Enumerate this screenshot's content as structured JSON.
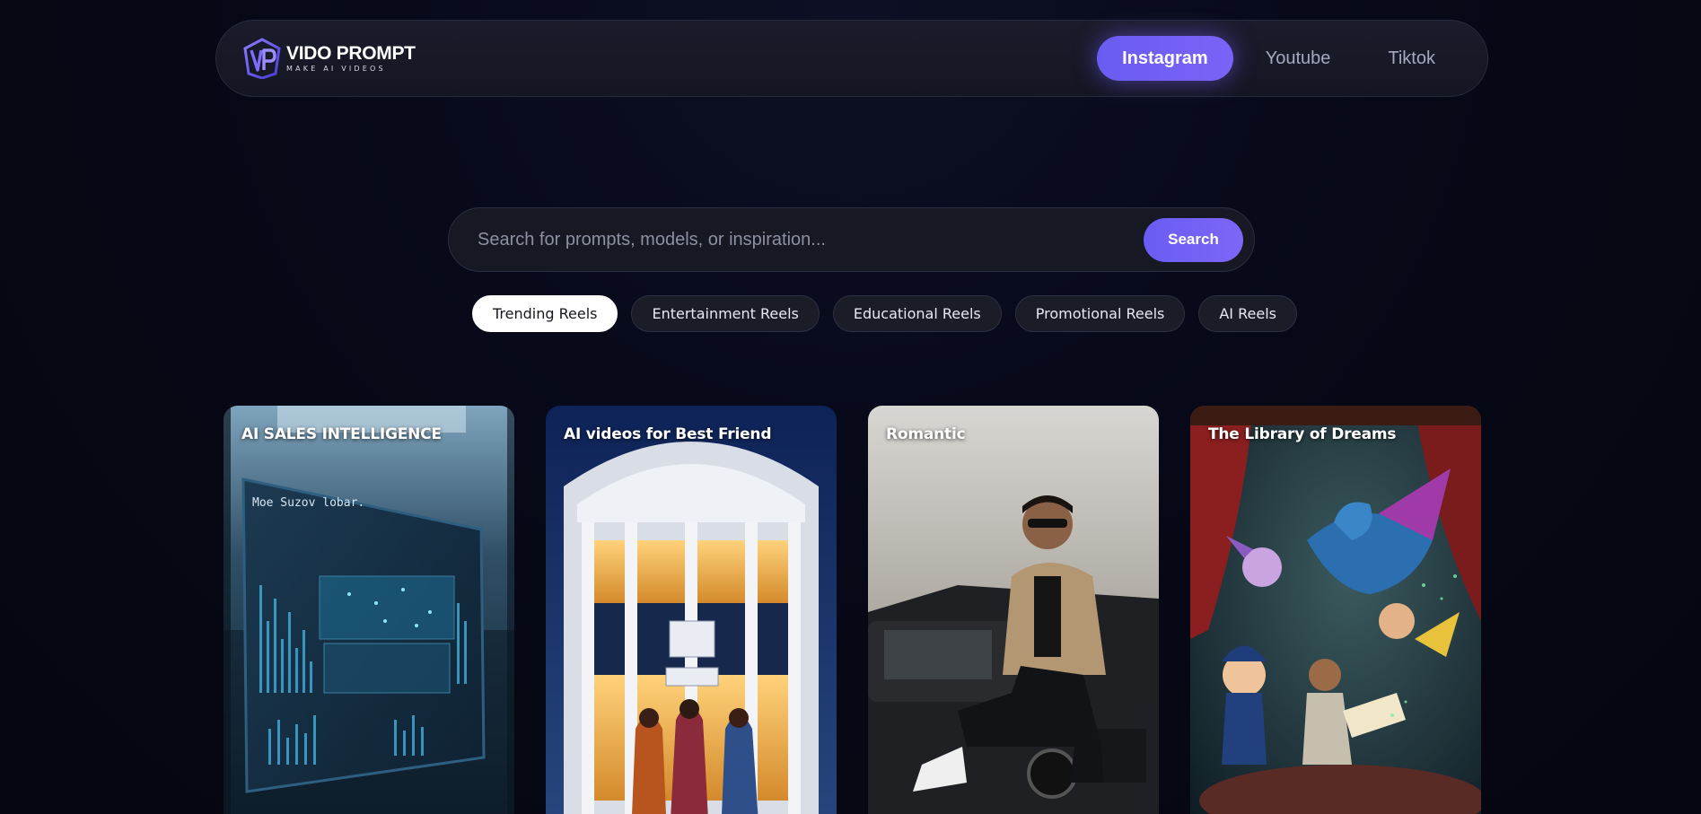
{
  "brand": {
    "name": "VIDO PROMPT",
    "tagline": "MAKE AI VIDEOS",
    "logo_icon": "vp-shield-logo-icon"
  },
  "nav": {
    "tabs": [
      {
        "label": "Instagram",
        "active": true
      },
      {
        "label": "Youtube",
        "active": false
      },
      {
        "label": "Tiktok",
        "active": false
      }
    ]
  },
  "search": {
    "placeholder": "Search for prompts, models, or inspiration...",
    "value": "",
    "button_label": "Search"
  },
  "filters": [
    {
      "label": "Trending Reels",
      "active": true
    },
    {
      "label": "Entertainment Reels",
      "active": false
    },
    {
      "label": "Educational Reels",
      "active": false
    },
    {
      "label": "Promotional Reels",
      "active": false
    },
    {
      "label": "AI Reels",
      "active": false
    }
  ],
  "cards": [
    {
      "title": "AI SALES INTELLIGENCE",
      "image": "holographic-dashboard-image"
    },
    {
      "title": "AI videos for Best Friend",
      "image": "illuminated-building-image"
    },
    {
      "title": "Romantic",
      "image": "man-on-car-image"
    },
    {
      "title": "The Library of Dreams",
      "image": "fantasy-dragon-image"
    }
  ],
  "colors": {
    "accent": "#6c5df3",
    "background": "#060814",
    "nav_bg": "#171928",
    "chip_bg": "#1a1c28"
  }
}
